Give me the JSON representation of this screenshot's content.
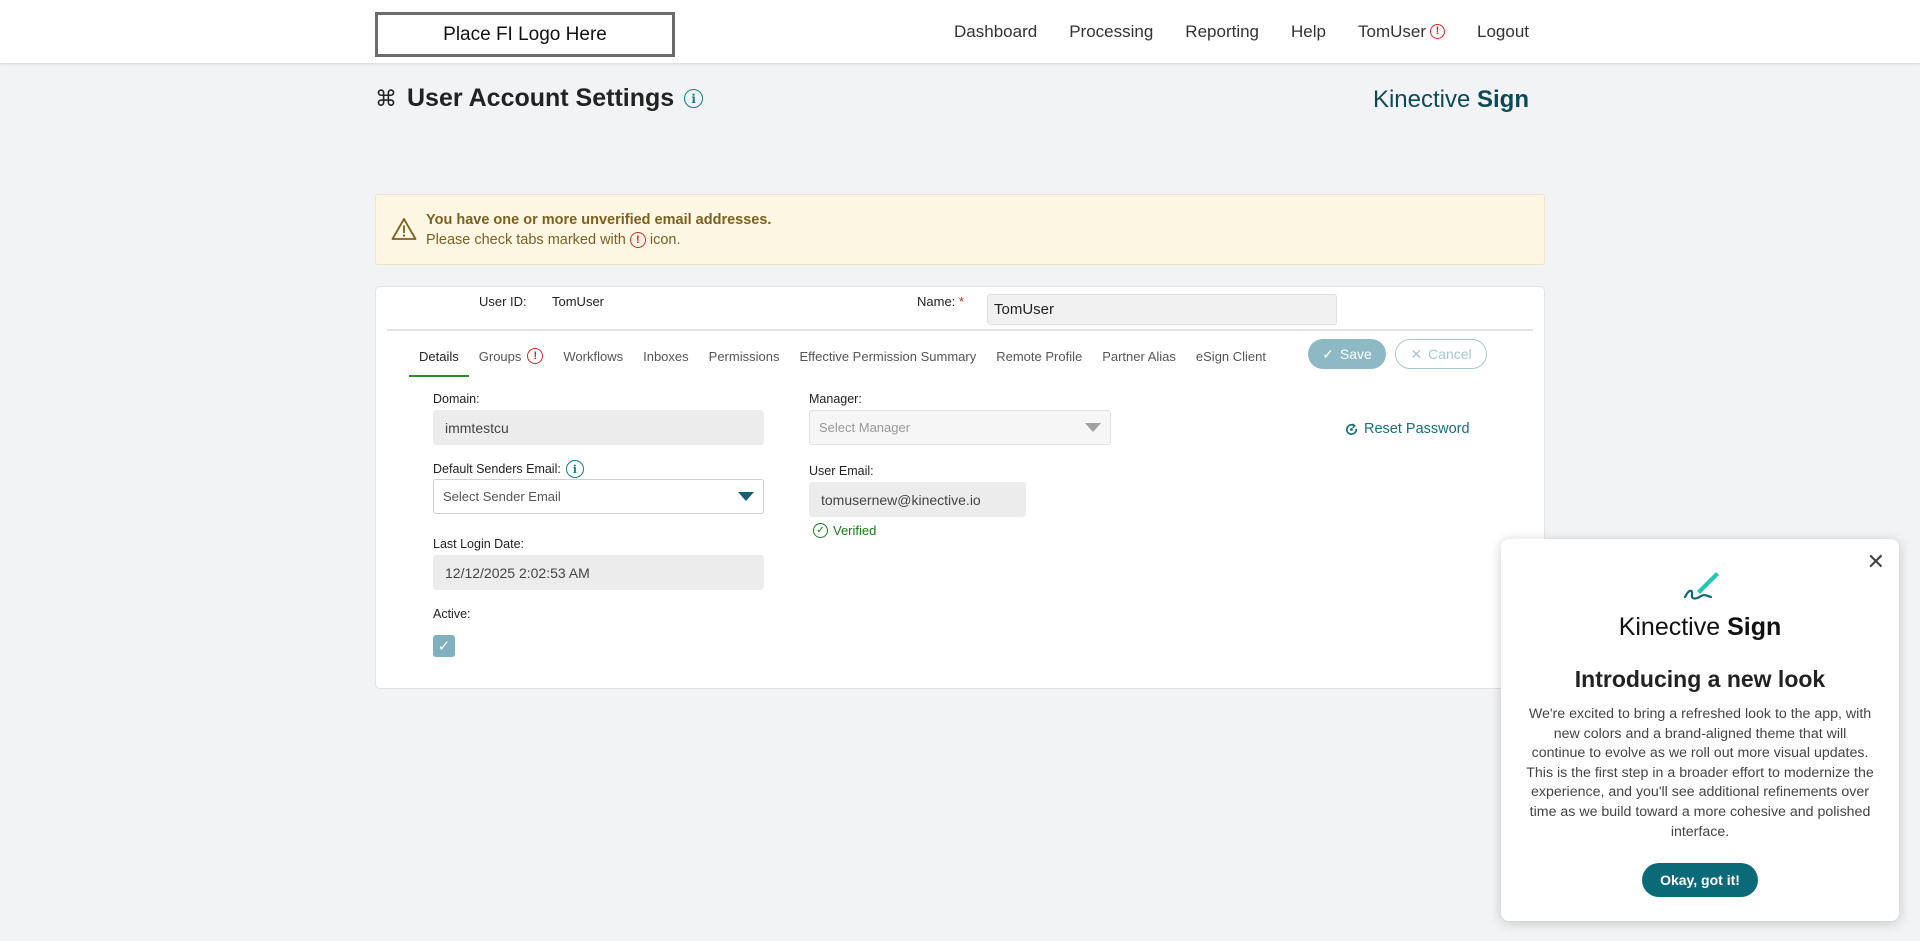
{
  "header": {
    "logo_text": "Place FI Logo Here",
    "nav": {
      "dashboard": "Dashboard",
      "processing": "Processing",
      "reporting": "Reporting",
      "help": "Help",
      "user": "TomUser",
      "logout": "Logout"
    }
  },
  "page": {
    "title": "User Account Settings",
    "brand_light": "Kinective",
    "brand_bold": "Sign"
  },
  "warning": {
    "title": "You have one or more unverified email addresses.",
    "text_before": "Please check tabs marked with",
    "text_after": "icon."
  },
  "account": {
    "user_id_label": "User ID:",
    "user_id_value": "TomUser",
    "name_label": "Name:",
    "name_required": "*",
    "name_value": "TomUser"
  },
  "tabs": {
    "details": "Details",
    "groups": "Groups",
    "workflows": "Workflows",
    "inboxes": "Inboxes",
    "permissions": "Permissions",
    "effective_permission_summary": "Effective Permission Summary",
    "remote_profile": "Remote Profile",
    "partner_alias": "Partner Alias",
    "esign_client": "eSign Client"
  },
  "actions": {
    "save": "Save",
    "cancel": "Cancel",
    "reset_password": "Reset Password"
  },
  "form": {
    "domain_label": "Domain:",
    "domain_value": "immtestcu",
    "default_senders_email_label": "Default Senders Email:",
    "default_senders_email_placeholder": "Select Sender Email",
    "last_login_label": "Last Login Date:",
    "last_login_value": "12/12/2025 2:02:53 AM",
    "active_label": "Active:",
    "active_checked": true,
    "manager_label": "Manager:",
    "manager_placeholder": "Select Manager",
    "user_email_label": "User Email:",
    "user_email_value": "tomusernew@kinective.io",
    "verified_text": "Verified"
  },
  "popup": {
    "brand_light": "Kinective",
    "brand_bold": "Sign",
    "title": "Introducing a new look",
    "body": "We're excited to bring a refreshed look to the app, with new colors and a brand-aligned theme that will continue to evolve as we roll out more visual updates. This is the first step in a broader effort to modernize the experience, and you'll see additional refinements over time as we build toward a more cohesive and polished interface.",
    "button": "Okay, got it!"
  },
  "colors": {
    "accent": "#0b6a78",
    "alert": "#d62828",
    "success": "#1a7a1a",
    "warning_bg": "#fdf6e3",
    "warning_text": "#7a6021"
  }
}
